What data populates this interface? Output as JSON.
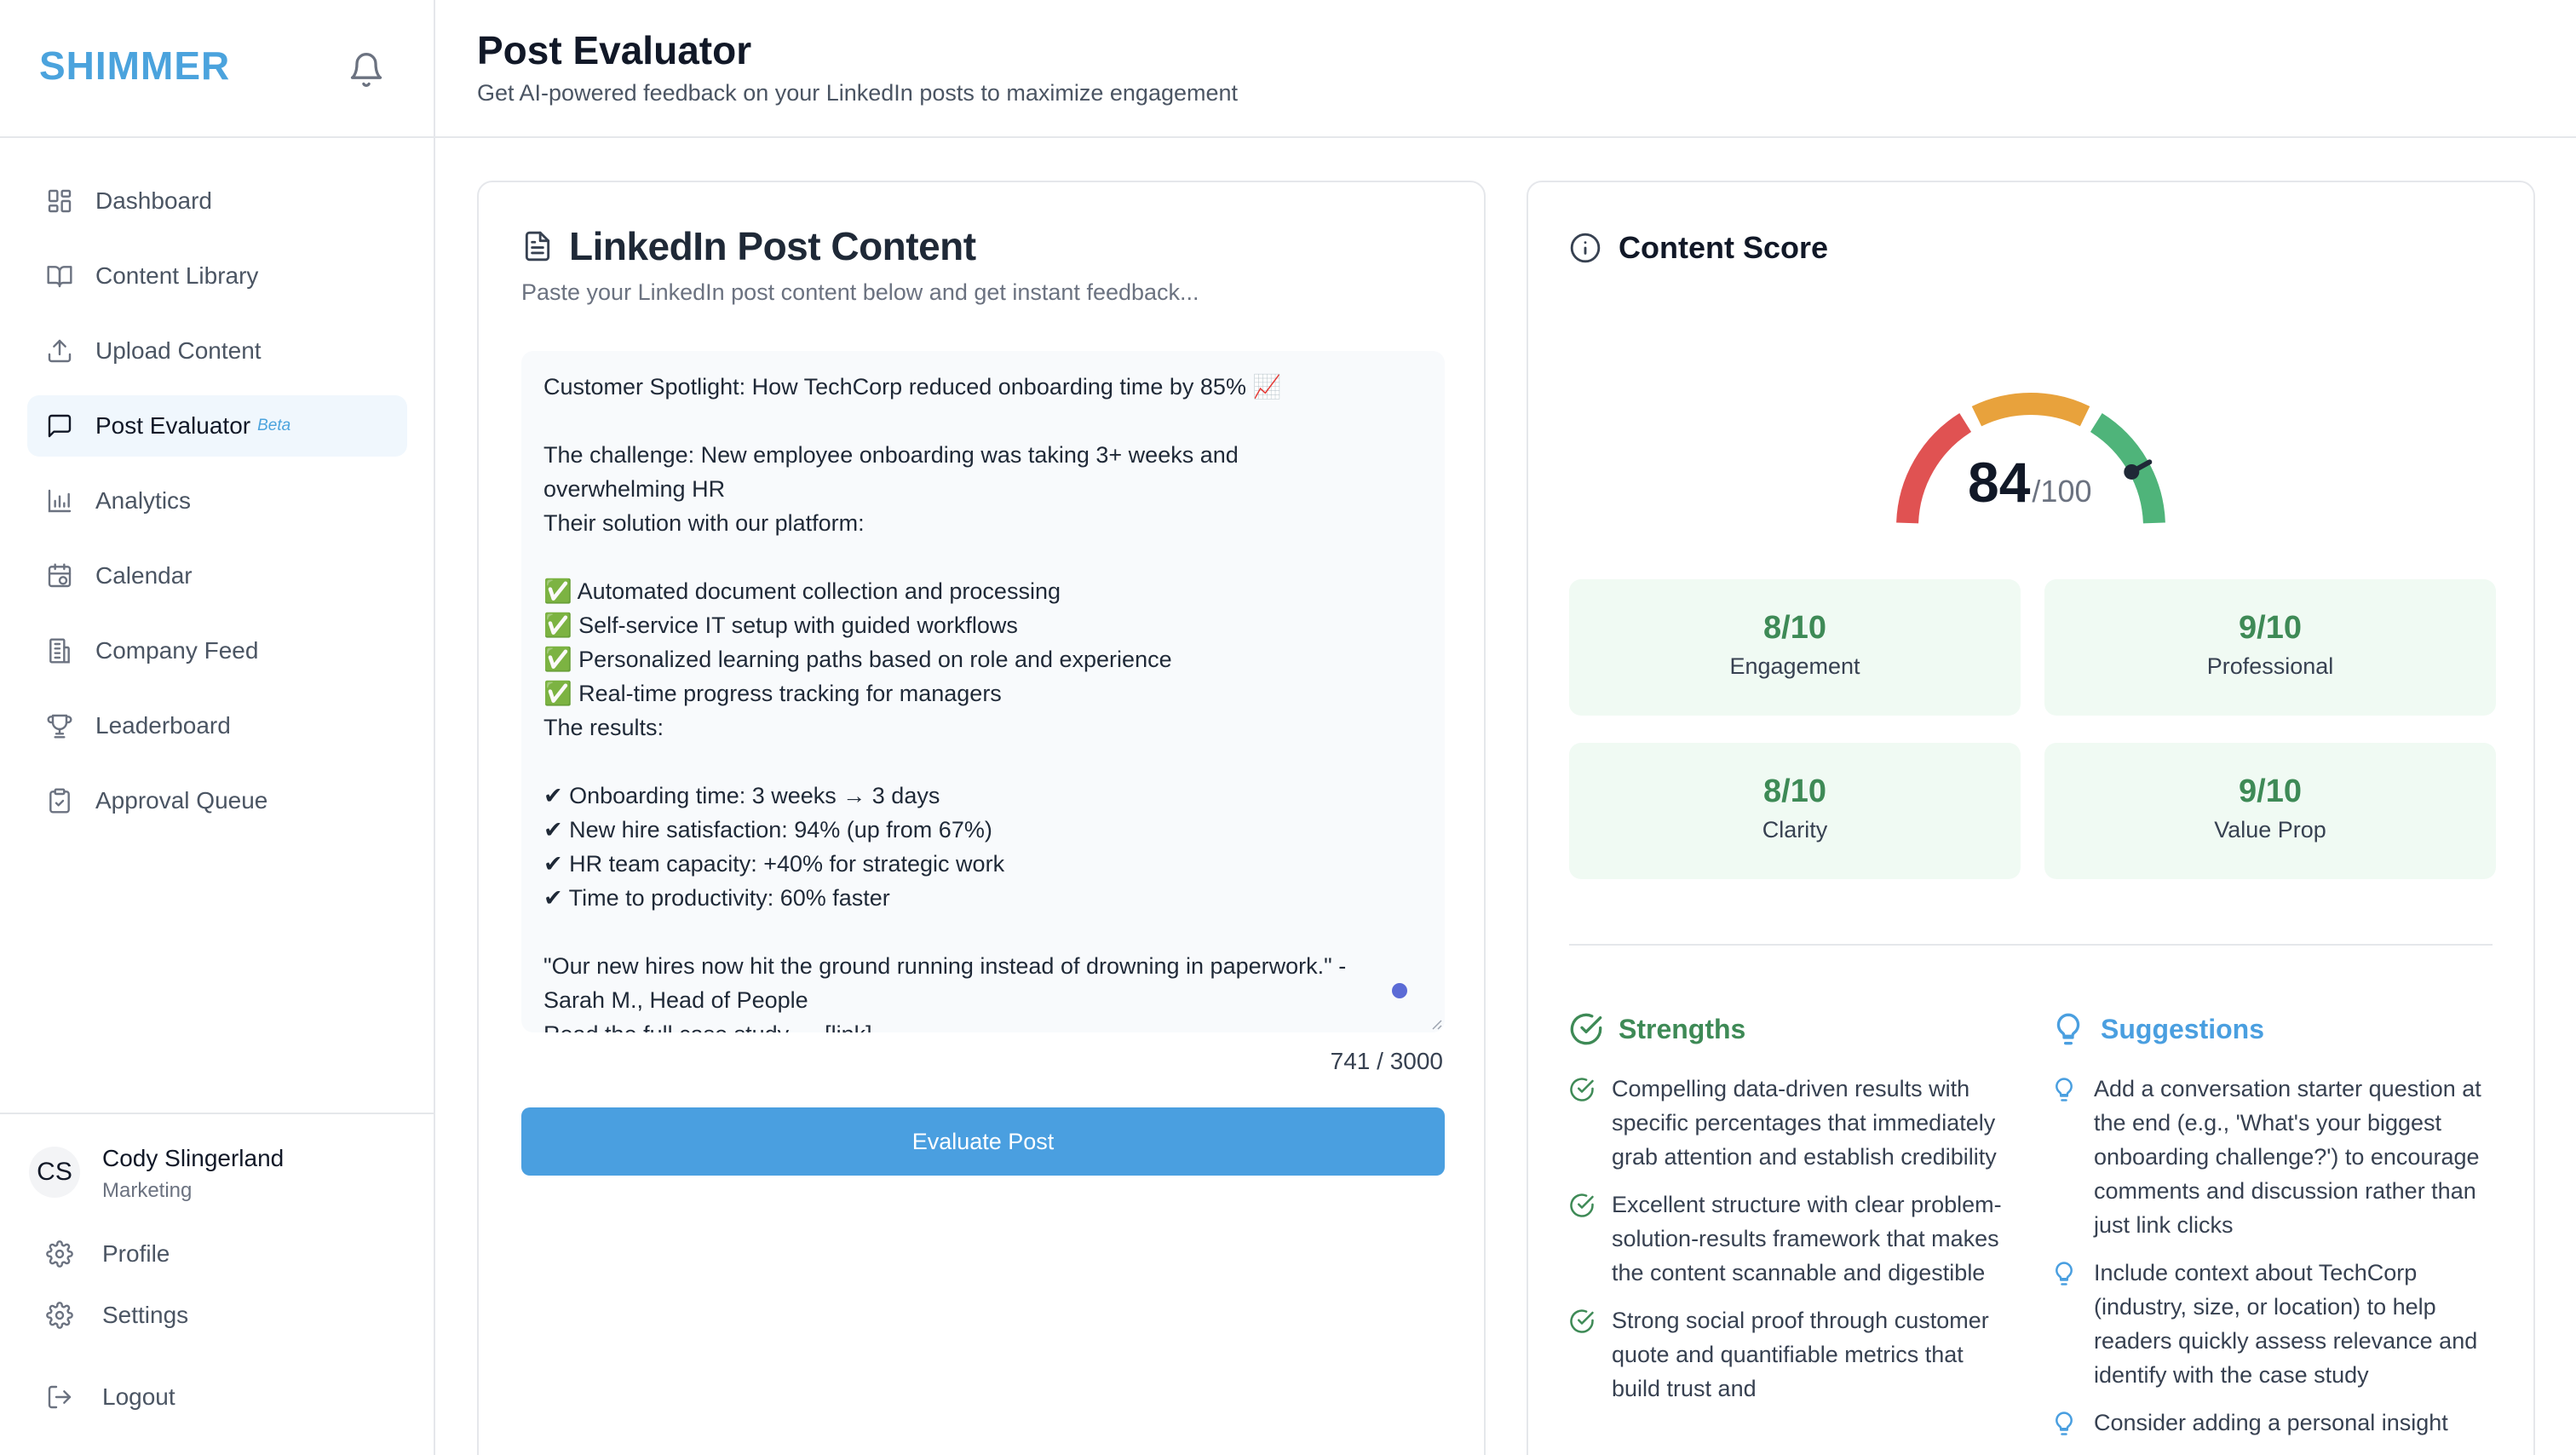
{
  "app": {
    "brand": "SHIMMER"
  },
  "nav": {
    "items": [
      {
        "label": "Dashboard",
        "icon": "dashboard-icon"
      },
      {
        "label": "Content Library",
        "icon": "book-icon"
      },
      {
        "label": "Upload Content",
        "icon": "upload-icon"
      },
      {
        "label": "Post Evaluator",
        "icon": "message-icon",
        "badge": "Beta"
      },
      {
        "label": "Analytics",
        "icon": "bar-chart-icon"
      },
      {
        "label": "Calendar",
        "icon": "calendar-icon"
      },
      {
        "label": "Company Feed",
        "icon": "building-icon"
      },
      {
        "label": "Leaderboard",
        "icon": "trophy-icon"
      },
      {
        "label": "Approval Queue",
        "icon": "clipboard-icon"
      }
    ]
  },
  "user": {
    "initials": "CS",
    "name": "Cody Slingerland",
    "role": "Marketing",
    "profile_label": "Profile",
    "settings_label": "Settings",
    "logout_label": "Logout"
  },
  "header": {
    "title": "Post Evaluator",
    "subtitle": "Get AI-powered feedback on your LinkedIn posts to maximize engagement"
  },
  "post": {
    "title": "LinkedIn Post Content",
    "subtitle": "Paste your LinkedIn post content below and get instant feedback...",
    "lines": [
      "Customer Spotlight: How TechCorp reduced onboarding time by 85% 📈",
      "",
      "The challenge: New employee onboarding was taking 3+ weeks and",
      "overwhelming HR",
      "Their solution with our platform:",
      "",
      "✅ Automated document collection and processing",
      "✅ Self-service IT setup with guided workflows",
      "✅ Personalized learning paths based on role and experience",
      "✅ Real-time progress tracking for managers",
      "The results:",
      "",
      "✔ Onboarding time: 3 weeks → 3 days",
      "✔ New hire satisfaction: 94% (up from 67%)",
      "✔ HR team capacity: +40% for strategic work",
      "✔ Time to productivity: 60% faster",
      "",
      "\"Our new hires now hit the ground running instead of drowning in paperwork.\" -",
      "Sarah M., Head of People",
      "Read the full case study → [link]"
    ],
    "char_count": "741 / 3000",
    "button_label": "Evaluate Post"
  },
  "score": {
    "title": "Content Score",
    "value": "84",
    "max": "/100",
    "value_fraction": 0.84,
    "colors": {
      "low": "#e05252",
      "mid": "#e8a23c",
      "high": "#4fb47a",
      "needle": "#1f2937"
    },
    "metrics": [
      {
        "value": "8/10",
        "label": "Engagement"
      },
      {
        "value": "9/10",
        "label": "Professional"
      },
      {
        "value": "8/10",
        "label": "Clarity"
      },
      {
        "value": "9/10",
        "label": "Value Prop"
      }
    ]
  },
  "strengths": {
    "title": "Strengths",
    "color": "#3e8a56",
    "items": [
      "Compelling data-driven results with specific percentages that immediately grab attention and establish credibility",
      "Excellent structure with clear problem-solution-results framework that makes the content scannable and digestible",
      "Strong social proof through customer quote and quantifiable metrics that build trust and"
    ]
  },
  "suggestions": {
    "title": "Suggestions",
    "color": "#4a9fe0",
    "items": [
      "Add a conversation starter question at the end (e.g., 'What's your biggest onboarding challenge?') to encourage comments and discussion rather than just link clicks",
      "Include context about TechCorp (industry, size, or location) to help readers quickly assess relevance and identify with the case study",
      "Consider adding a personal insight"
    ]
  }
}
